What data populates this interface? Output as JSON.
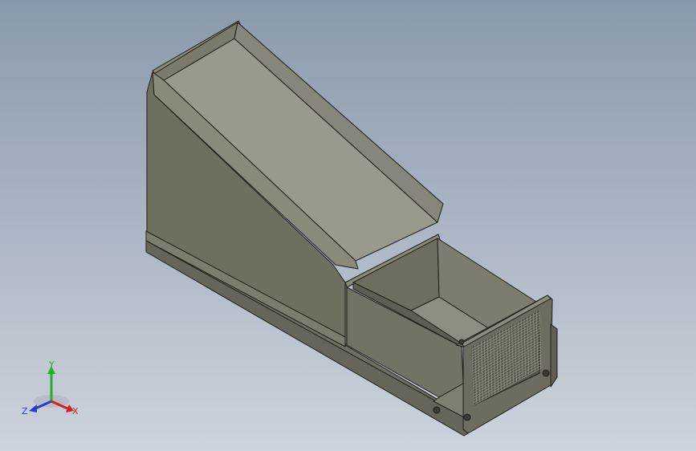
{
  "view": {
    "background_top": "#8a99ab",
    "background_bottom": "#cdd3dc",
    "model_color": "#7b7b6c",
    "edge_color": "#1e1e1a"
  },
  "triad": {
    "x_label": "X",
    "y_label": "Y",
    "z_label": "Z",
    "x_color": "#d42020",
    "y_color": "#22b02a",
    "z_color": "#2a3ccc"
  }
}
